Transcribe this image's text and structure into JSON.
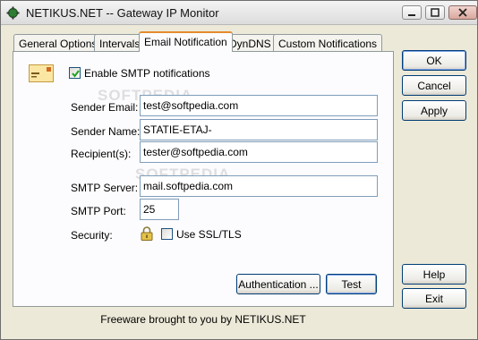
{
  "window": {
    "title": "NETIKUS.NET -- Gateway IP Monitor"
  },
  "tabs": [
    {
      "label": "General Options"
    },
    {
      "label": "Intervals"
    },
    {
      "label": "Email Notification",
      "active": true
    },
    {
      "label": "DynDNS"
    },
    {
      "label": "Custom Notifications"
    }
  ],
  "email": {
    "enable_label": "Enable SMTP notifications",
    "enable_checked": true,
    "sender_email_label": "Sender Email:",
    "sender_email_value": "test@softpedia.com",
    "sender_name_label": "Sender Name:",
    "sender_name_value": "STATIE-ETAJ-",
    "recipient_label": "Recipient(s):",
    "recipient_value": "tester@softpedia.com",
    "smtp_server_label": "SMTP Server:",
    "smtp_server_value": "mail.softpedia.com",
    "smtp_port_label": "SMTP Port:",
    "smtp_port_value": "25",
    "security_label": "Security:",
    "ssl_label": "Use SSL/TLS",
    "ssl_checked": false,
    "authentication_label": "Authentication ...",
    "test_label": "Test"
  },
  "side_buttons": {
    "ok": "OK",
    "cancel": "Cancel",
    "apply": "Apply",
    "help": "Help",
    "exit": "Exit"
  },
  "footer": "Freeware brought to you by NETIKUS.NET",
  "icons": [
    "app-icon",
    "minimize-icon",
    "maximize-icon",
    "close-icon",
    "envelope-icon",
    "checkmark-icon",
    "lock-icon"
  ],
  "colors": {
    "active_tab_accent": "#e68b2c",
    "input_border": "#7f9db9",
    "button_border": "#003c74"
  }
}
